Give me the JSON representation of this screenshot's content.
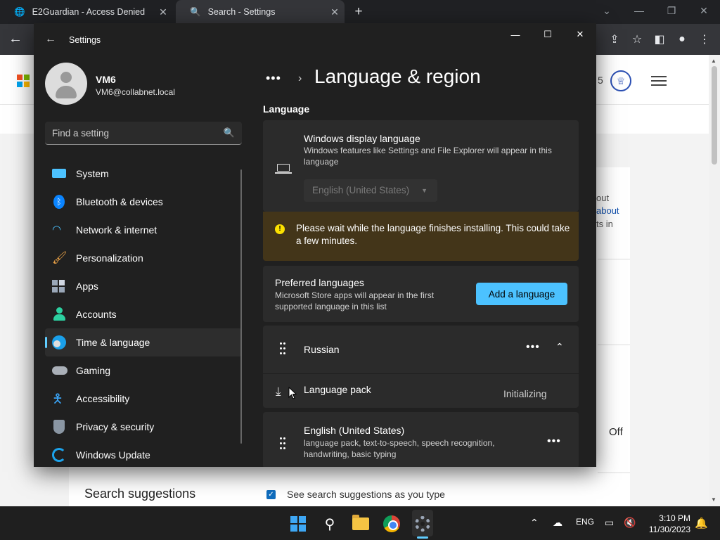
{
  "browser": {
    "tabs": [
      {
        "title": "E2Guardian - Access Denied"
      },
      {
        "title": "Search - Settings"
      }
    ],
    "new_tab": "+"
  },
  "webpage": {
    "badge_count": "5",
    "text_lines": [
      "out",
      "about",
      "ts in"
    ],
    "off_label": "Off",
    "suggestions_title": "Search suggestions",
    "suggestions_checkbox": "See search suggestions as you type",
    "logo_colors": [
      "#f25022",
      "#7fba00",
      "#00a4ef",
      "#ffb900"
    ]
  },
  "settings": {
    "window_title": "Settings",
    "profile": {
      "name": "VM6",
      "email": "VM6@collabnet.local"
    },
    "search_placeholder": "Find a setting",
    "nav": [
      {
        "label": "System",
        "icon": "monitor-icon"
      },
      {
        "label": "Bluetooth & devices",
        "icon": "bluetooth-icon"
      },
      {
        "label": "Network & internet",
        "icon": "wifi-icon"
      },
      {
        "label": "Personalization",
        "icon": "brush-icon"
      },
      {
        "label": "Apps",
        "icon": "apps-icon"
      },
      {
        "label": "Accounts",
        "icon": "person-icon"
      },
      {
        "label": "Time & language",
        "icon": "globe-clock-icon",
        "active": true
      },
      {
        "label": "Gaming",
        "icon": "gamepad-icon"
      },
      {
        "label": "Accessibility",
        "icon": "accessibility-icon"
      },
      {
        "label": "Privacy & security",
        "icon": "shield-icon"
      },
      {
        "label": "Windows Update",
        "icon": "refresh-icon"
      }
    ],
    "breadcrumb_more": "•••",
    "page_title": "Language & region",
    "section_language": "Language",
    "display_language": {
      "title": "Windows display language",
      "description": "Windows features like Settings and File Explorer will appear in this language",
      "selected": "English (United States)"
    },
    "warning": {
      "icon": "!",
      "text": "Please wait while the language finishes installing. This could take a few minutes."
    },
    "preferred": {
      "title": "Preferred languages",
      "description": "Microsoft Store apps will appear in the first supported language in this list",
      "add_button": "Add a language"
    },
    "languages": [
      {
        "name": "Russian",
        "sub_title": "Language pack",
        "sub_status": "Initializing"
      },
      {
        "name": "English (United States)",
        "features": "language pack, text-to-speech, speech recognition, handwriting, basic typing"
      }
    ],
    "more_dots": "•••"
  },
  "taskbar": {
    "language": "ENG",
    "time": "3:10 PM",
    "date": "11/30/2023"
  }
}
